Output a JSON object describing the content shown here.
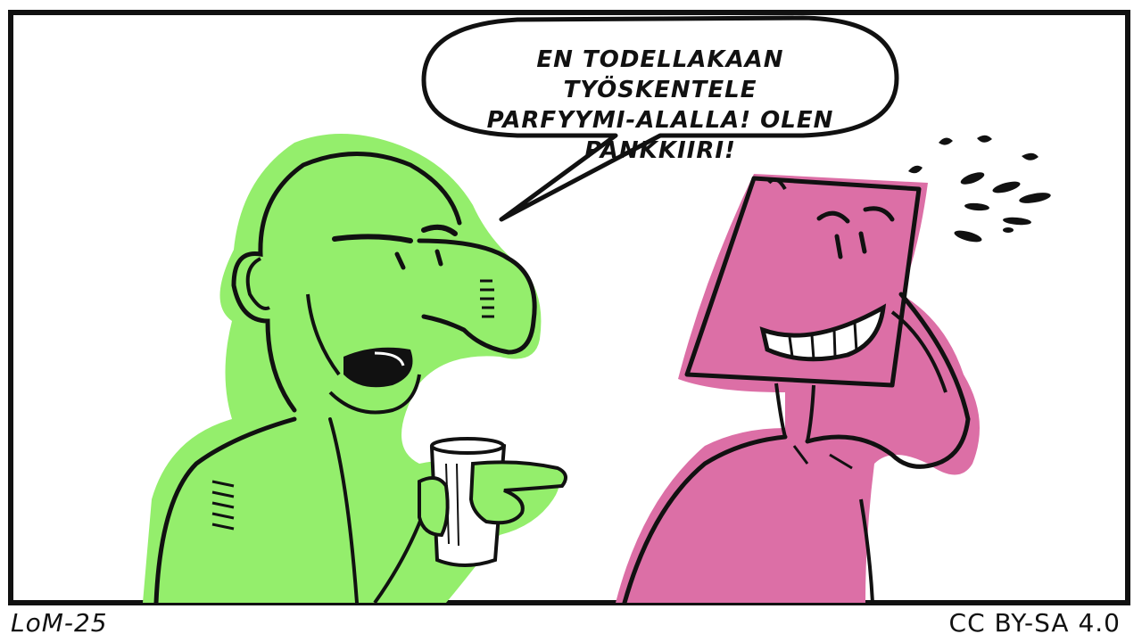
{
  "comic": {
    "speech_bubble": {
      "line1": "EN TODELLAKAAN TYÖSKENTELE",
      "line2": "PARFYYMI-ALALLA! OLEN PANKKIIRI!"
    },
    "signature": "LoM-25",
    "license": "CC BY-SA 4.0"
  },
  "colors": {
    "green_character": "#94ee6c",
    "pink_character": "#dc6fa6",
    "ink": "#111111",
    "background": "#ffffff"
  },
  "icons": {
    "cup": "paper-cup-icon",
    "sweat": "sweat-drops-icon"
  }
}
